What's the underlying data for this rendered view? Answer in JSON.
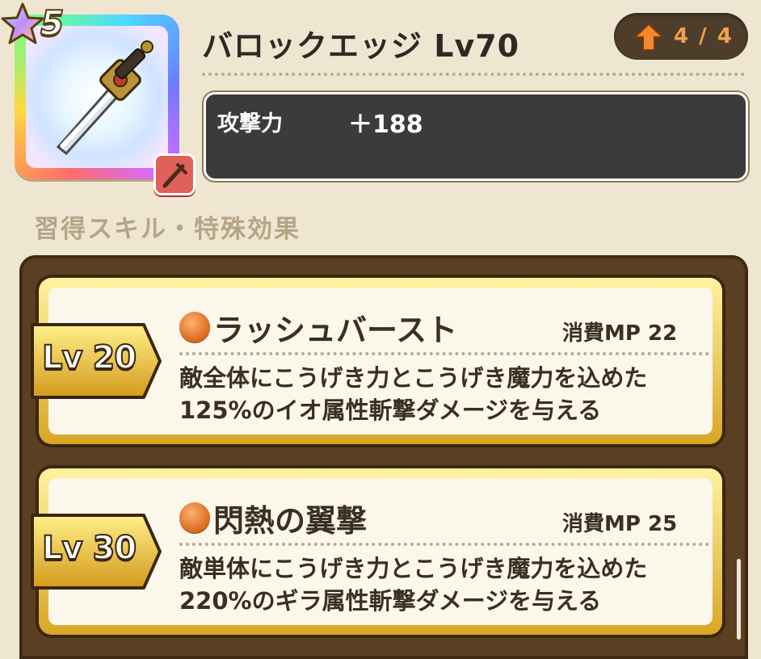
{
  "item": {
    "rarity": "5",
    "name": "バロックエッジ Lv70",
    "upgrade": "4 / 4",
    "stat_label": "攻撃力",
    "stat_value": "＋188",
    "icon": "sword-icon",
    "type_icon": "dagger-icon"
  },
  "section_title": "習得スキル・特殊効果",
  "skills": [
    {
      "level": "Lv 20",
      "name": "ラッシュバースト",
      "mp": "消費MP 22",
      "desc_1": "敵全体にこうげき力とこうげき魔力を込めた",
      "desc_2": "125%のイオ属性斬撃ダメージを与える"
    },
    {
      "level": "Lv 30",
      "name": "閃熱の翼撃",
      "mp": "消費MP 25",
      "desc_1": "敵単体にこうげき力とこうげき魔力を込めた",
      "desc_2": "220%のギラ属性斬撃ダメージを与える"
    }
  ],
  "colors": {
    "background": "#efe6d2",
    "panel": "#5b3f22",
    "gold": "#d8a626",
    "upgrade": "#f2a24a"
  }
}
